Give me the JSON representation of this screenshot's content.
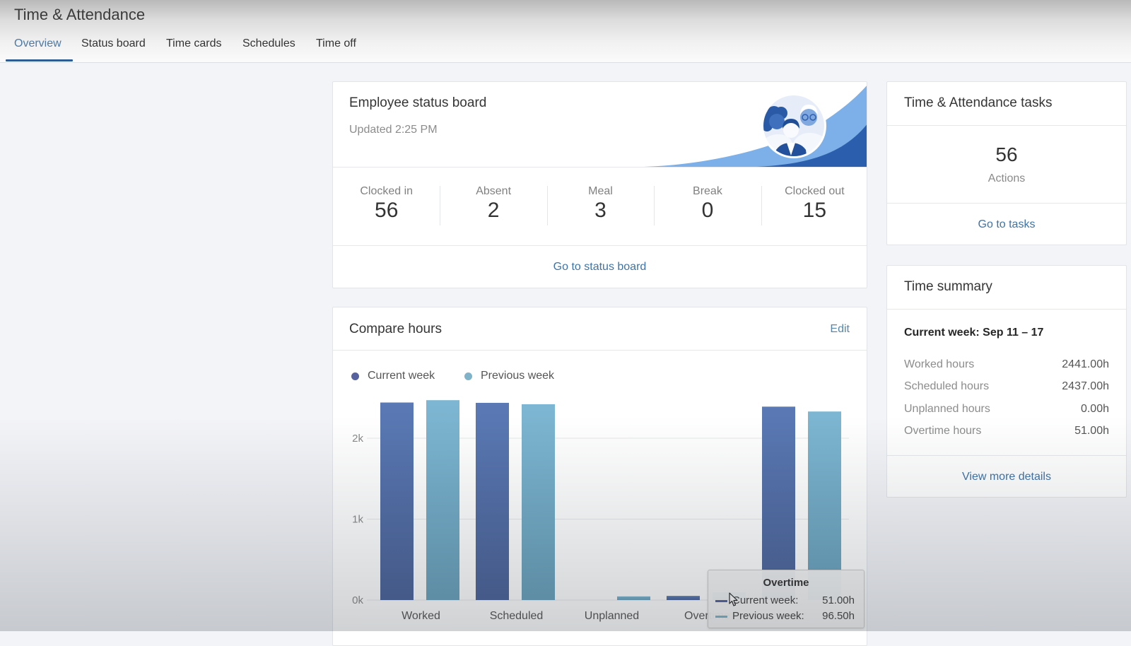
{
  "app": {
    "title": "Time & Attendance"
  },
  "header": {
    "tabs": [
      {
        "label": "Overview",
        "active": true
      },
      {
        "label": "Status board",
        "active": false
      },
      {
        "label": "Time cards",
        "active": false
      },
      {
        "label": "Schedules",
        "active": false
      },
      {
        "label": "Time off",
        "active": false
      }
    ]
  },
  "status_board": {
    "title": "Employee status board",
    "updated": "Updated 2:25 PM",
    "illustration": "team-people-illustration",
    "stats": [
      {
        "label": "Clocked in",
        "value": "56"
      },
      {
        "label": "Absent",
        "value": "2"
      },
      {
        "label": "Meal",
        "value": "3"
      },
      {
        "label": "Break",
        "value": "0"
      },
      {
        "label": "Clocked out",
        "value": "15"
      }
    ],
    "link": "Go to status board"
  },
  "tasks": {
    "title": "Time & Attendance tasks",
    "count": "56",
    "count_label": "Actions",
    "link": "Go to tasks"
  },
  "time_summary": {
    "title": "Time summary",
    "period_label": "Current week:",
    "period": "Sep 11 – 17",
    "rows": [
      {
        "label": "Worked hours",
        "value": "2441.00h"
      },
      {
        "label": "Scheduled hours",
        "value": "2437.00h"
      },
      {
        "label": "Unplanned hours",
        "value": "0.00h"
      },
      {
        "label": "Overtime hours",
        "value": "51.00h"
      }
    ],
    "link": "View more details"
  },
  "compare_hours": {
    "title": "Compare hours",
    "edit_label": "Edit",
    "legend": [
      {
        "label": "Current week",
        "color": "#55629f"
      },
      {
        "label": "Previous week",
        "color": "#7fb3c9"
      }
    ],
    "tooltip": {
      "title": "Overtime",
      "rows": [
        {
          "label": "Current week:",
          "value": "51.00h",
          "color": "#55629f"
        },
        {
          "label": "Previous week:",
          "value": "96.50h",
          "color": "#7fb3c9"
        }
      ]
    }
  },
  "colors": {
    "accent": "#2d5d92",
    "active_tab": "#4b7aa6",
    "link": "#3f73a6",
    "current_week_bar": "#5670ab",
    "previous_week_bar": "#76aecb",
    "illustration_light": "#7db0e8",
    "illustration_dark": "#2b5fad"
  },
  "chart_data": {
    "type": "bar",
    "title": "Compare hours",
    "categories": [
      "Worked",
      "Scheduled",
      "Unplanned",
      "Overtime",
      ""
    ],
    "series": [
      {
        "name": "Current week",
        "values": [
          2441,
          2437,
          0,
          51,
          2390
        ]
      },
      {
        "name": "Previous week",
        "values": [
          2470,
          2420,
          45,
          96.5,
          2330
        ]
      }
    ],
    "xlabel": "",
    "ylabel": "",
    "yticks": [
      0,
      1000,
      2000
    ],
    "ytick_labels": [
      "0k",
      "1k",
      "2k"
    ],
    "ylim": [
      0,
      2500
    ],
    "grid": true,
    "legend": "top-left"
  }
}
